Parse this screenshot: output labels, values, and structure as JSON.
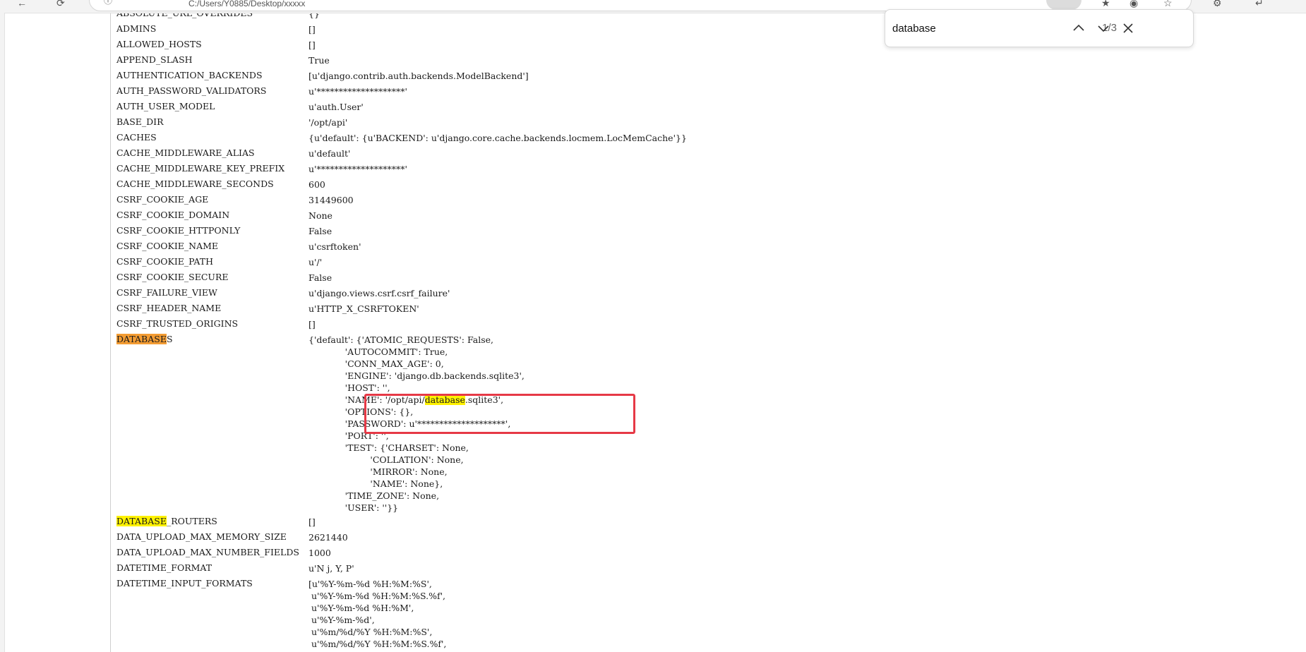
{
  "browser": {
    "url_text": "C:/Users/Y0885/Desktop/xxxxx"
  },
  "find_bar": {
    "query": "database",
    "count": "1/3"
  },
  "settings": [
    {
      "key": "ABSOLUTE_URL_OVERRIDES",
      "value": "{}"
    },
    {
      "key": "ADMINS",
      "value": "[]"
    },
    {
      "key": "ALLOWED_HOSTS",
      "value": "[]"
    },
    {
      "key": "APPEND_SLASH",
      "value": "True"
    },
    {
      "key": "AUTHENTICATION_BACKENDS",
      "value": "[u'django.contrib.auth.backends.ModelBackend']"
    },
    {
      "key": "AUTH_PASSWORD_VALIDATORS",
      "value": "u'********************'"
    },
    {
      "key": "AUTH_USER_MODEL",
      "value": "u'auth.User'"
    },
    {
      "key": "BASE_DIR",
      "value": "'/opt/api'"
    },
    {
      "key": "CACHES",
      "value": "{u'default': {u'BACKEND': u'django.core.cache.backends.locmem.LocMemCache'}}"
    },
    {
      "key": "CACHE_MIDDLEWARE_ALIAS",
      "value": "u'default'"
    },
    {
      "key": "CACHE_MIDDLEWARE_KEY_PREFIX",
      "value": "u'********************'"
    },
    {
      "key": "CACHE_MIDDLEWARE_SECONDS",
      "value": "600"
    },
    {
      "key": "CSRF_COOKIE_AGE",
      "value": "31449600"
    },
    {
      "key": "CSRF_COOKIE_DOMAIN",
      "value": "None"
    },
    {
      "key": "CSRF_COOKIE_HTTPONLY",
      "value": "False"
    },
    {
      "key": "CSRF_COOKIE_NAME",
      "value": "u'csrftoken'"
    },
    {
      "key": "CSRF_COOKIE_PATH",
      "value": "u'/'"
    },
    {
      "key": "CSRF_COOKIE_SECURE",
      "value": "False"
    },
    {
      "key": "CSRF_FAILURE_VIEW",
      "value": "u'django.views.csrf.csrf_failure'"
    },
    {
      "key": "CSRF_HEADER_NAME",
      "value": "u'HTTP_X_CSRFTOKEN'"
    },
    {
      "key": "CSRF_TRUSTED_ORIGINS",
      "value": "[]"
    }
  ],
  "databases": {
    "key_match": "DATABASE",
    "key_rest": "S",
    "lines": [
      "{'default': {'ATOMIC_REQUESTS': False,",
      "             'AUTOCOMMIT': True,",
      "             'CONN_MAX_AGE': 0,",
      "             'ENGINE': 'django.db.backends.sqlite3',",
      "             'HOST': '',"
    ],
    "name_prefix": "             'NAME': '/opt/api/",
    "name_match": "database",
    "name_suffix": ".sqlite3',",
    "lines_after": [
      "             'OPTIONS': {},",
      "             'PASSWORD': u'********************',",
      "             'PORT': '',",
      "             'TEST': {'CHARSET': None,",
      "                      'COLLATION': None,",
      "                      'MIRROR': None,",
      "                      'NAME': None},",
      "             'TIME_ZONE': None,",
      "             'USER': ''}}"
    ]
  },
  "routers": {
    "key_match": "DATABASE",
    "key_rest": "_ROUTERS",
    "value": "[]"
  },
  "settings_after": [
    {
      "key": "DATA_UPLOAD_MAX_MEMORY_SIZE",
      "value": "2621440"
    },
    {
      "key": "DATA_UPLOAD_MAX_NUMBER_FIELDS",
      "value": "1000"
    },
    {
      "key": "DATETIME_FORMAT",
      "value": "u'N j, Y, P'"
    }
  ],
  "datetime_input_formats": {
    "key": "DATETIME_INPUT_FORMATS",
    "lines": [
      "[u'%Y-%m-%d %H:%M:%S',",
      " u'%Y-%m-%d %H:%M:%S.%f',",
      " u'%Y-%m-%d %H:%M',",
      " u'%Y-%m-%d',",
      " u'%m/%d/%Y %H:%M:%S',",
      " u'%m/%d/%Y %H:%M:%S.%f',"
    ]
  },
  "colors": {
    "highlight_current": "#f39c33",
    "highlight_match": "#fff200",
    "annotation_box": "#e63946"
  }
}
